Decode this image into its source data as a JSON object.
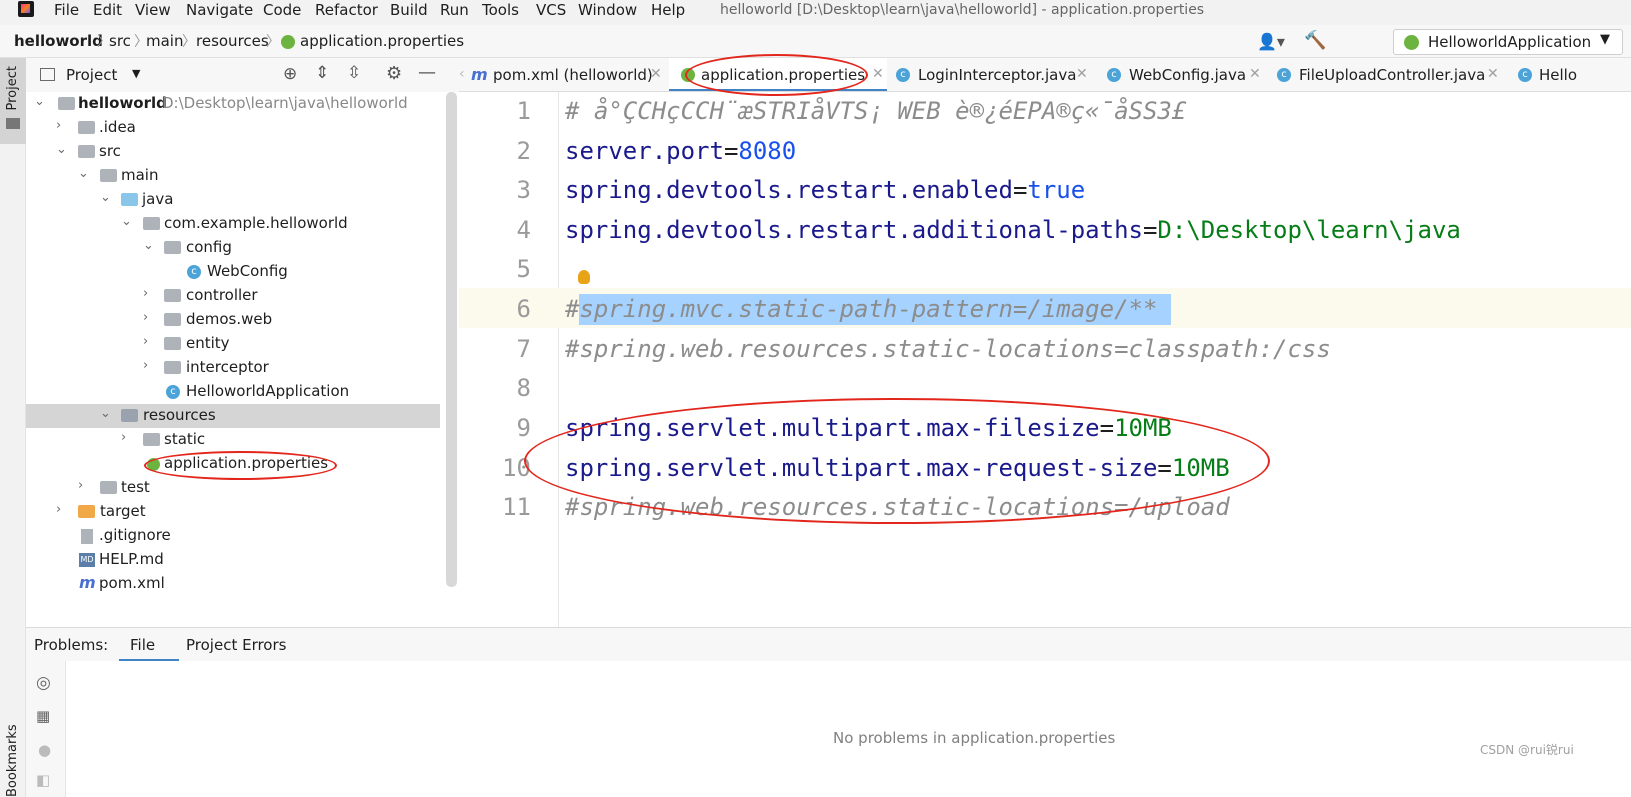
{
  "menubar": {
    "items": [
      "File",
      "Edit",
      "View",
      "Navigate",
      "Code",
      "Refactor",
      "Build",
      "Run",
      "Tools",
      "VCS",
      "Window",
      "Help"
    ],
    "title": "helloworld [D:\\Desktop\\learn\\java\\helloworld] - application.properties"
  },
  "breadcrumb": [
    "helloworld",
    "src",
    "main",
    "resources",
    "application.properties"
  ],
  "run_config": "HelloworldApplication",
  "left_strip": {
    "project_label": "Project",
    "bookmarks_label": "Bookmarks"
  },
  "project_panel": {
    "title": "Project"
  },
  "tabs": [
    {
      "label": "pom.xml (helloworld)",
      "icon": "maven-icon"
    },
    {
      "label": "application.properties",
      "icon": "spring-leaf-icon",
      "active": true
    },
    {
      "label": "LoginInterceptor.java",
      "icon": "class-icon"
    },
    {
      "label": "WebConfig.java",
      "icon": "class-icon"
    },
    {
      "label": "FileUploadController.java",
      "icon": "class-icon"
    },
    {
      "label": "Hello",
      "icon": "spring-class-icon"
    }
  ],
  "tree": [
    {
      "label": "helloworld",
      "path": "D:\\Desktop\\learn\\java\\helloworld",
      "bold": true
    },
    {
      "label": ".idea"
    },
    {
      "label": "src"
    },
    {
      "label": "main"
    },
    {
      "label": "java"
    },
    {
      "label": "com.example.helloworld"
    },
    {
      "label": "config"
    },
    {
      "label": "WebConfig"
    },
    {
      "label": "controller"
    },
    {
      "label": "demos.web"
    },
    {
      "label": "entity"
    },
    {
      "label": "interceptor"
    },
    {
      "label": "HelloworldApplication"
    },
    {
      "label": "resources"
    },
    {
      "label": "static"
    },
    {
      "label": "application.properties"
    },
    {
      "label": "test"
    },
    {
      "label": "target"
    },
    {
      "label": ".gitignore"
    },
    {
      "label": "HELP.md"
    },
    {
      "label": "pom.xml"
    }
  ],
  "editor": {
    "line_numbers": [
      "1",
      "2",
      "3",
      "4",
      "5",
      "6",
      "7",
      "8",
      "9",
      "10",
      "11"
    ],
    "lines": [
      {
        "comment": "# å°ÇCHçCCH¨æSTRIåVTS¡ WEB è®¿éEPA®ç«¯åSS3£"
      },
      {
        "key": "server.port",
        "eq": "=",
        "val": "8080"
      },
      {
        "key": "spring.devtools.restart.enabled",
        "eq": "=",
        "val": "true"
      },
      {
        "key": "spring.devtools.restart.additional-paths",
        "eq": "=",
        "val": "D:\\Desktop\\learn\\java"
      },
      {},
      {
        "hash": "#",
        "comment": "spring.mvc.static-path-pattern=/image/**"
      },
      {
        "comment": "#spring.web.resources.static-locations=classpath:/css"
      },
      {},
      {
        "key": "spring.servlet.multipart.max-filesize",
        "eq": "=",
        "val": "10MB"
      },
      {
        "key": "spring.servlet.multipart.max-request-size",
        "eq": "=",
        "val": "10MB"
      },
      {
        "comment": "#spring.web.resources.static-locations=/upload"
      }
    ]
  },
  "problems": {
    "label": "Problems:",
    "tabs": [
      "File",
      "Project Errors"
    ],
    "empty_text": "No problems in application.properties"
  },
  "watermark": "CSDN @rui锐rui",
  "colors": {
    "annotation_red": "#e3261c",
    "selection": "#a6d2ff",
    "caret_row": "#fcfaed"
  }
}
